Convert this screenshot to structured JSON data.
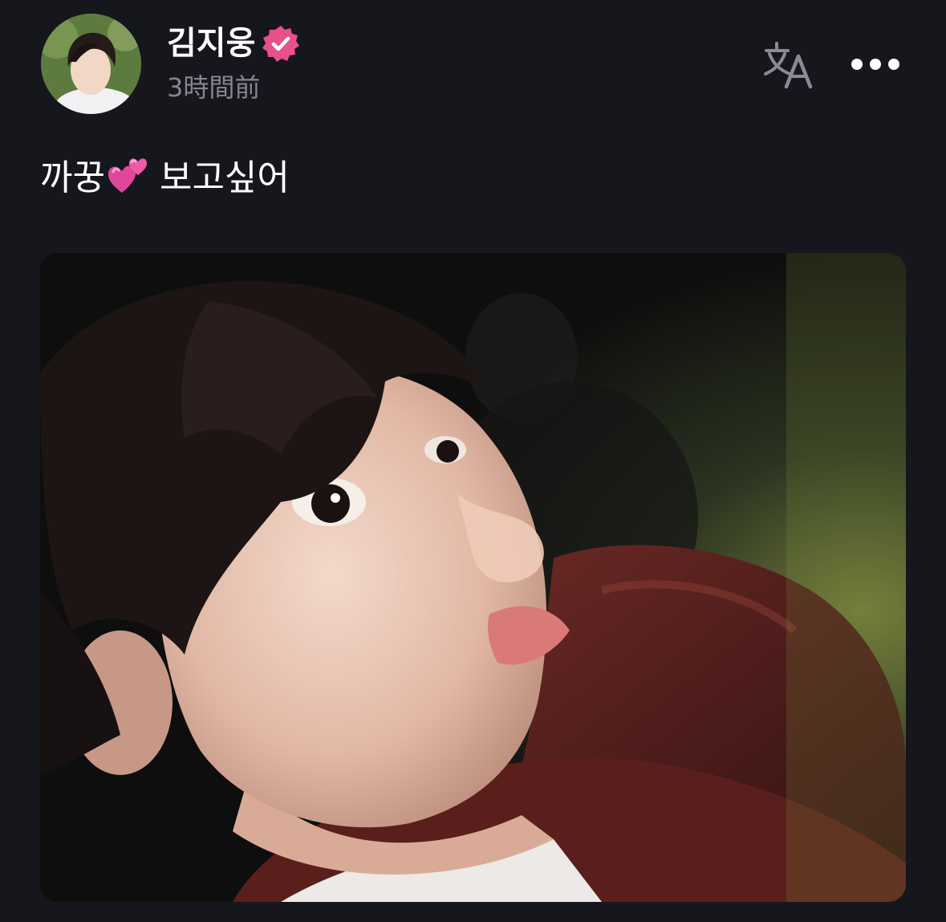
{
  "author": {
    "name": "김지웅",
    "verified": true,
    "badge_color": "#e8508c",
    "avatar_icon": "profile-photo"
  },
  "post": {
    "time": "3時間前",
    "text_before_emoji": "까꿍",
    "emoji": "two-hearts",
    "text_after_emoji": "보고싶어",
    "photo": "selfie-photo"
  },
  "actions": {
    "translate_icon": "translate-icon",
    "more_icon": "more-horizontal-icon"
  },
  "colors": {
    "background": "#16161d",
    "secondary_text": "#85858f",
    "icon": "#8a8a94"
  }
}
